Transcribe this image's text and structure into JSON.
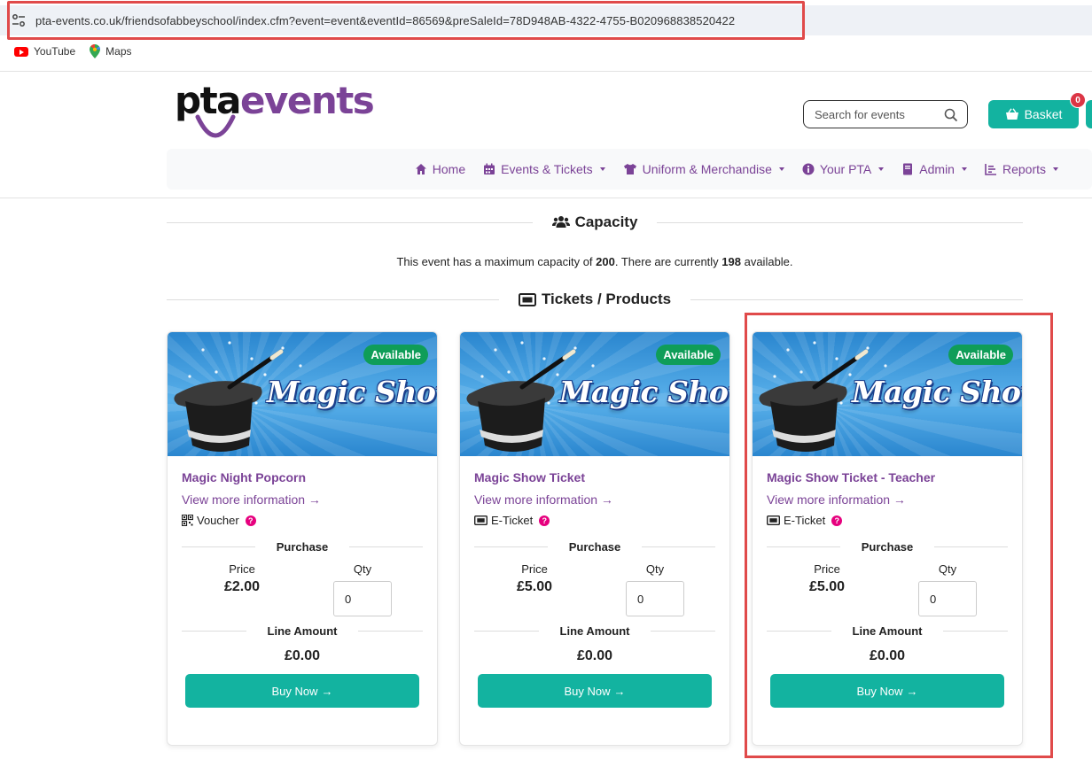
{
  "browser": {
    "url": "pta-events.co.uk/friendsofabbeyschool/index.cfm?event=event&eventId=86569&preSaleId=78D948AB-4322-4755-B020968838520422",
    "bookmarks": [
      {
        "label": "YouTube",
        "icon": "youtube-icon"
      },
      {
        "label": "Maps",
        "icon": "maps-icon"
      }
    ]
  },
  "header": {
    "logo_left": "pta",
    "logo_right": "events",
    "search_placeholder": "Search for events",
    "basket_label": "Basket",
    "basket_count": "0"
  },
  "nav": [
    {
      "label": "Home",
      "icon": "home-icon",
      "dropdown": false
    },
    {
      "label": "Events & Tickets",
      "icon": "calendar-icon",
      "dropdown": true
    },
    {
      "label": "Uniform & Merchandise",
      "icon": "shirt-icon",
      "dropdown": true
    },
    {
      "label": "Your PTA",
      "icon": "info-icon",
      "dropdown": true
    },
    {
      "label": "Admin",
      "icon": "book-icon",
      "dropdown": true
    },
    {
      "label": "Reports",
      "icon": "chart-icon",
      "dropdown": true
    }
  ],
  "capacity": {
    "heading": "Capacity",
    "text_prefix": "This event has a maximum capacity of ",
    "max": "200",
    "text_middle": ". There are currently ",
    "available": "198",
    "text_suffix": " available."
  },
  "tickets_heading": "Tickets / Products",
  "card_labels": {
    "banner_title": "Magic Show",
    "more_info": "View more information",
    "purchase": "Purchase",
    "price": "Price",
    "qty": "Qty",
    "line_amount": "Line Amount",
    "buy_now": "Buy Now"
  },
  "products": [
    {
      "name": "Magic Night Popcorn",
      "status": "Available",
      "type": "Voucher",
      "price": "£2.00",
      "qty": "0",
      "amount": "£0.00"
    },
    {
      "name": "Magic Show Ticket",
      "status": "Available",
      "type": "E-Ticket",
      "price": "£5.00",
      "qty": "0",
      "amount": "£0.00"
    },
    {
      "name": "Magic Show Ticket - Teacher",
      "status": "Available",
      "type": "E-Ticket",
      "price": "£5.00",
      "qty": "0",
      "amount": "£0.00"
    }
  ],
  "colors": {
    "brand_purple": "#7b4397",
    "teal": "#13b3a0",
    "badge_green": "#0f9d58",
    "annotation_red": "#e04a4a"
  }
}
